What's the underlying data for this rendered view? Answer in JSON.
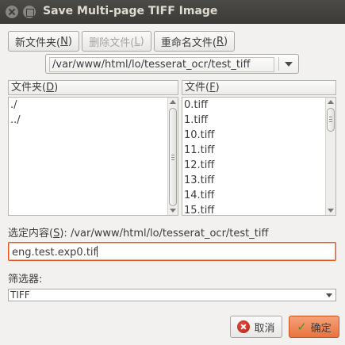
{
  "window": {
    "title": "Save Multi-page TIFF Image"
  },
  "toolbar": {
    "new_folder": {
      "text": "新文件夹(",
      "mnemonic": "N",
      "close": ")"
    },
    "delete_file": {
      "text": "删除文件(",
      "mnemonic": "L",
      "close": ")"
    },
    "rename_file": {
      "text": "重命名文件(",
      "mnemonic": "R",
      "close": ")"
    }
  },
  "path_combo": {
    "value": "/var/www/html/lo/tesserat_ocr/test_tiff"
  },
  "folders": {
    "header": {
      "text": "文件夹(",
      "mnemonic": "D",
      "close": ")"
    },
    "items": [
      "./",
      "../"
    ]
  },
  "files": {
    "header": {
      "text": "文件(",
      "mnemonic": "F",
      "close": ")"
    },
    "items": [
      "0.tiff",
      "1.tiff",
      "10.tiff",
      "11.tiff",
      "12.tiff",
      "13.tiff",
      "14.tiff",
      "15.tiff"
    ]
  },
  "selection": {
    "label": {
      "text": "选定内容(",
      "mnemonic": "S",
      "close": "):"
    },
    "path": "/var/www/html/lo/tesserat_ocr/test_tiff"
  },
  "filename_entry": {
    "value": "eng.test.exp0.tif"
  },
  "filter": {
    "label": "筛选器:",
    "selected": "TIFF"
  },
  "actions": {
    "cancel": "取消",
    "ok": "确定"
  },
  "colors": {
    "accent": "#e95420",
    "titlebar": "#3c3b37",
    "window_bg": "#f2f1f0"
  }
}
